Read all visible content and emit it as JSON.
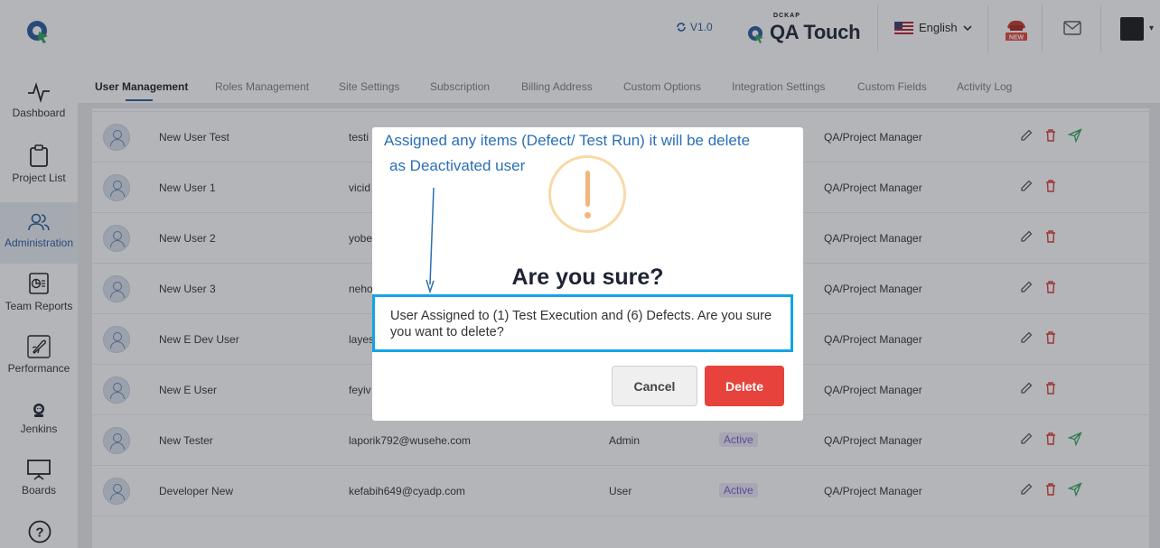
{
  "header": {
    "version": "V1.0",
    "brand_small": "DCKAP",
    "brand_main": "QA Touch",
    "language": "English",
    "new_badge": "NEW"
  },
  "sidebar": {
    "items": [
      {
        "label": "Dashboard",
        "icon": "pulse-icon"
      },
      {
        "label": "Project List",
        "icon": "clipboard-icon"
      },
      {
        "label": "Administration",
        "icon": "users-icon",
        "active": true
      },
      {
        "label": "Team Reports",
        "icon": "report-icon"
      },
      {
        "label": "Performance",
        "icon": "rocket-icon"
      },
      {
        "label": "Jenkins",
        "icon": "jenkins-icon"
      },
      {
        "label": "Boards",
        "icon": "board-icon"
      }
    ]
  },
  "tabs": [
    "User Management",
    "Roles Management",
    "Site Settings",
    "Subscription",
    "Billing Address",
    "Custom Options",
    "Integration Settings",
    "Custom Fields",
    "Activity Log"
  ],
  "rows": [
    {
      "name": "New User Test",
      "email": "testi",
      "role": "",
      "status": "",
      "site_role": "QA/Project Manager",
      "send": true
    },
    {
      "name": "New User 1",
      "email": "vicid",
      "role": "",
      "status": "",
      "site_role": "QA/Project Manager",
      "send": false
    },
    {
      "name": "New User 2",
      "email": "yobe",
      "role": "",
      "status": "",
      "site_role": "QA/Project Manager",
      "send": false
    },
    {
      "name": "New User 3",
      "email": "neho",
      "role": "",
      "status": "",
      "site_role": "QA/Project Manager",
      "send": false
    },
    {
      "name": "New E Dev User",
      "email": "layes",
      "role": "",
      "status": "",
      "site_role": "QA/Project Manager",
      "send": false
    },
    {
      "name": "New E User",
      "email": "feyiv",
      "role": "",
      "status": "",
      "site_role": "QA/Project Manager",
      "send": false
    },
    {
      "name": "New Tester",
      "email": "laporik792@wusehe.com",
      "role": "Admin",
      "status": "Active",
      "site_role": "QA/Project Manager",
      "send": true
    },
    {
      "name": "Developer New",
      "email": "kefabih649@cyadp.com",
      "role": "User",
      "status": "Active",
      "site_role": "QA/Project Manager",
      "send": true
    }
  ],
  "modal": {
    "annotation_line1": "Assigned any items (Defect/ Test Run)  it will be delete",
    "annotation_line2": "as Deactivated user",
    "title": "Are you sure?",
    "message": "User Assigned to (1) Test Execution and (6) Defects. Are you sure you want to delete?",
    "cancel_label": "Cancel",
    "delete_label": "Delete"
  },
  "colors": {
    "accent": "#2a5b9e",
    "delete": "#e7423c",
    "highlight_border": "#14a3e6",
    "warning": "#f4b57a",
    "annotation": "#2a6fb5"
  }
}
